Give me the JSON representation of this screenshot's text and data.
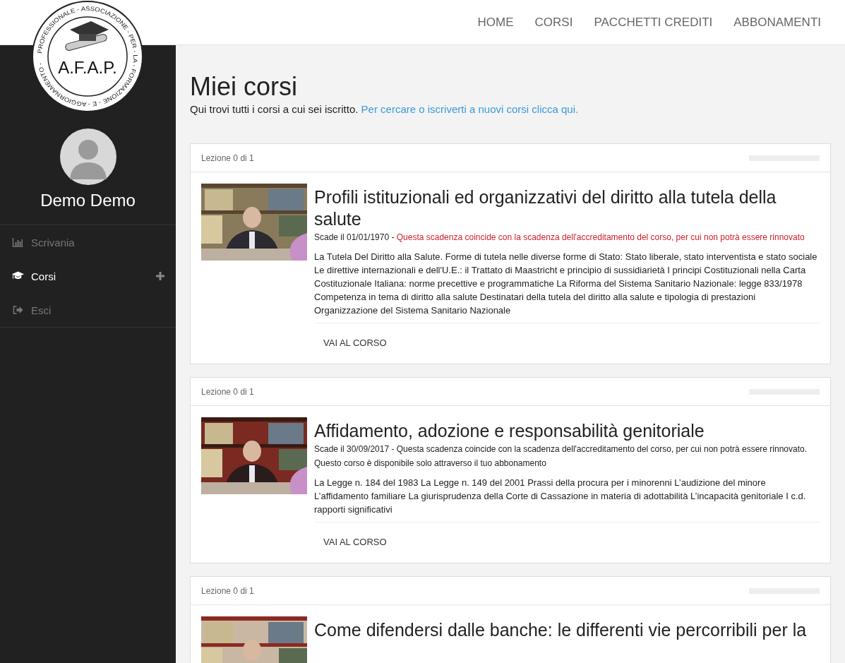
{
  "logo": {
    "initials": "A.F.A.P.",
    "ring_text": "PROFESSIONALE - ASSOCIAZIONE - PER - LA - FORMAZIONE - E - AGGIORNAMENTO -"
  },
  "nav": [
    {
      "label": "HOME"
    },
    {
      "label": "CORSI"
    },
    {
      "label": "PACCHETTI CREDITI"
    },
    {
      "label": "ABBONAMENTI"
    }
  ],
  "sidebar": {
    "user_name": "Demo Demo",
    "items": [
      {
        "label": "Scrivania",
        "selected": false,
        "expandable": false
      },
      {
        "label": "Corsi",
        "selected": true,
        "expandable": true
      },
      {
        "label": "Esci",
        "selected": false,
        "expandable": false
      }
    ]
  },
  "page": {
    "title": "Miei corsi",
    "intro": "Qui trovi tutti i corsi a cui sei iscritto.",
    "intro_link": "Per cercare o iscriverti a nuovi corsi clicca qui."
  },
  "courses": [
    {
      "progress_text": "Lezione 0 di 1",
      "level": 0,
      "title": "Profili istituzionali ed organizzativi del diritto alla tutela della salute",
      "deadline": "Scade il 01/01/1970 - ",
      "notice": "Questa scadenza coincide con la scadenza dell'accreditamento del corso, per cui non potrà essere rinnovato",
      "notice_alert": true,
      "description": "La Tutela Del Diritto alla Salute. Forme di tutela nelle diverse forme di Stato: Stato liberale, stato interventista e stato sociale Le direttive internazionali e dell'U.E.: il Trattato di Maastricht e principio di sussidiarietà I principi Costituzionali nella Carta Costituzionale Italiana: norme precettive e programmatiche La Riforma del Sistema Sanitario Nazionale: legge 833/1978 Competenza in tema di diritto alla salute Destinatari della tutela del diritto alla salute e tipologia di prestazioni Organizzazione del Sistema Sanitario Nazionale",
      "button": "VAI AL CORSO"
    },
    {
      "progress_text": "Lezione 0 di 1",
      "level": 0,
      "title": "Affidamento, adozione e responsabilità genitoriale",
      "deadline": "Scade il 30/09/2017 - ",
      "notice": "Questa scadenza coincide con la scadenza dell'accreditamento del corso, per cui non potrà essere rinnovato. Questo corso è disponibile solo attraverso il tuo abbonamento",
      "notice_alert": false,
      "description": "La Legge n. 184 del 1983 La Legge n. 149 del 2001 Prassi della procura per i minorenni L’audizione del minore L’affidamento familiare La giurisprudenza della Corte di Cassazione in materia di adottabilità L’incapacità genitoriale I c.d. rapporti significativi",
      "button": "VAI AL CORSO"
    },
    {
      "progress_text": "Lezione 0 di 1",
      "level": 0,
      "title": "Come difendersi dalle banche: le differenti vie percorribili per la"
    }
  ]
}
